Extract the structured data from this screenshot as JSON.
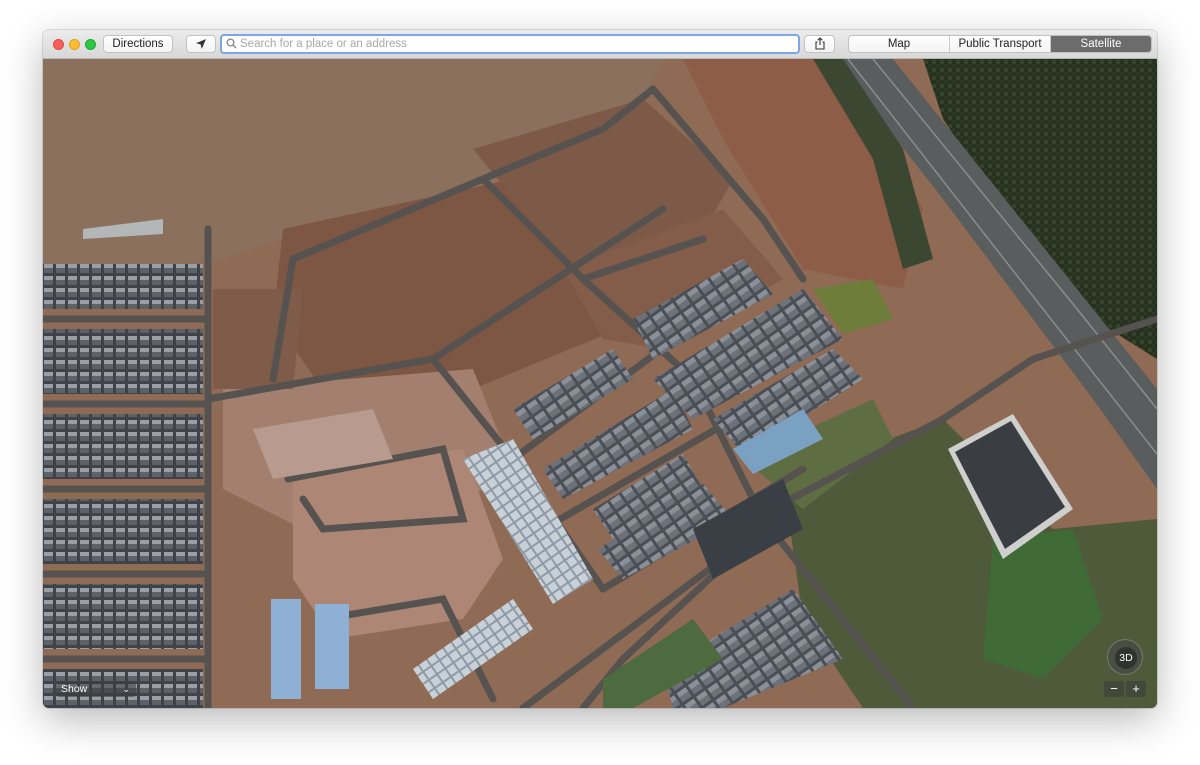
{
  "toolbar": {
    "directions_label": "Directions",
    "search_placeholder": "Search for a place or an address",
    "location_icon": "location-arrow-icon",
    "share_icon": "share-icon",
    "view_modes": [
      {
        "label": "Map",
        "active": false
      },
      {
        "label": "Public Transport",
        "active": false
      },
      {
        "label": "Satellite",
        "active": true
      }
    ]
  },
  "map": {
    "mode": "satellite",
    "show_label": "Show",
    "compass_label": "3D",
    "zoom_out_label": "−",
    "zoom_in_label": "+"
  },
  "colors": {
    "active_segment": "#6c6c6c",
    "search_focus": "#7aa7e8",
    "close": "#fc5f57",
    "minimize": "#fdbc2e",
    "maximize": "#28c840"
  }
}
